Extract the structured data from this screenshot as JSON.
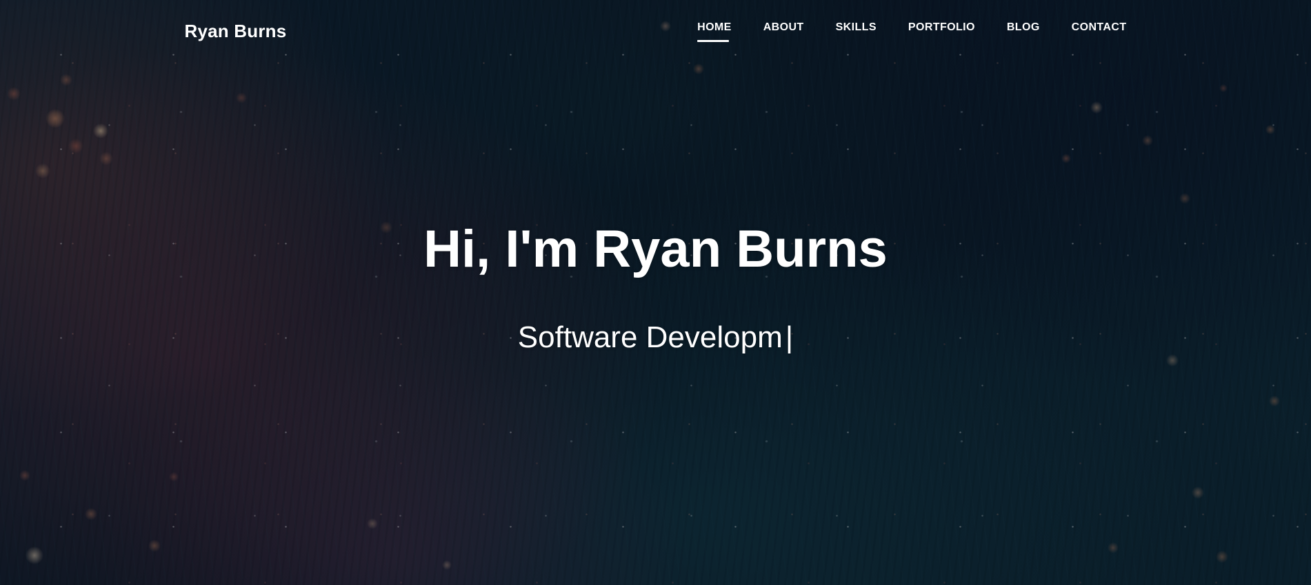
{
  "header": {
    "logo": "Ryan Burns",
    "nav": [
      {
        "label": "HOME",
        "active": true
      },
      {
        "label": "ABOUT",
        "active": false
      },
      {
        "label": "SKILLS",
        "active": false
      },
      {
        "label": "PORTFOLIO",
        "active": false
      },
      {
        "label": "BLOG",
        "active": false
      },
      {
        "label": "CONTACT",
        "active": false
      }
    ]
  },
  "hero": {
    "heading": "Hi, I'm Ryan Burns",
    "typed_text": "Software Developm",
    "cursor": "|"
  },
  "colors": {
    "text": "#ffffff",
    "background_base": "#0a1622",
    "background_teal": "#165460",
    "nebula_maroon": "#7a3442",
    "bokeh_orange": "#de9668",
    "active_underline": "#ffffff"
  }
}
